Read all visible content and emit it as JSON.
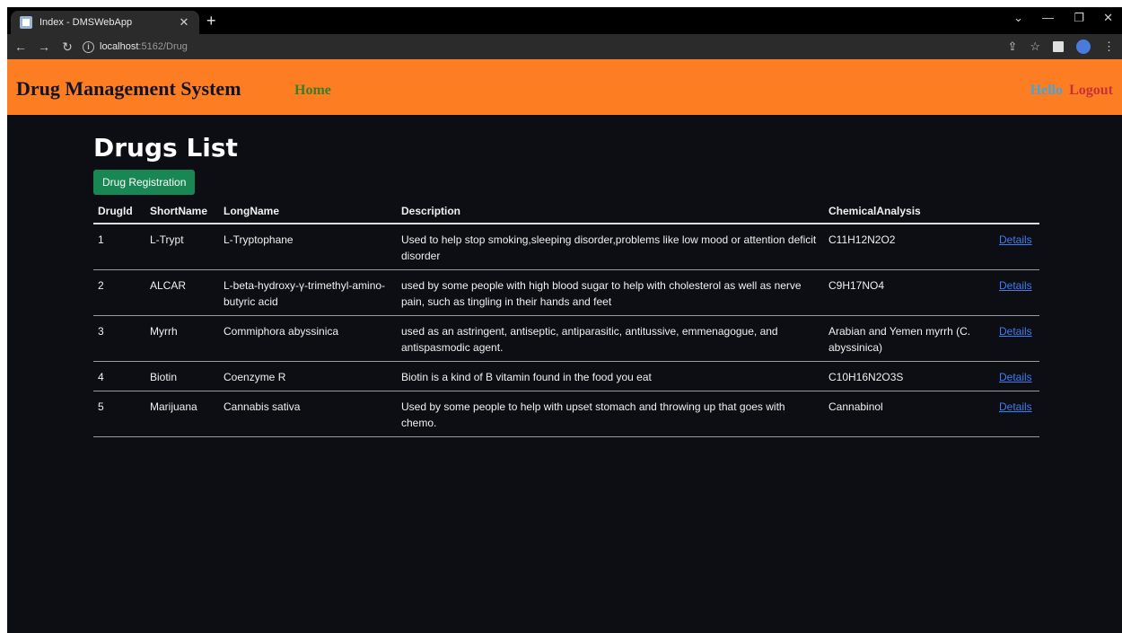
{
  "browser": {
    "tab_title": "Index - DMSWebApp",
    "url_host": "localhost",
    "url_path": ":5162/Drug"
  },
  "navbar": {
    "brand": "Drug Management System",
    "home": "Home",
    "hello": "Hello",
    "logout": "Logout"
  },
  "page": {
    "title": "Drugs List",
    "register_button": "Drug Registration"
  },
  "table": {
    "headers": [
      "DrugId",
      "ShortName",
      "LongName",
      "Description",
      "ChemicalAnalysis",
      ""
    ],
    "rows": [
      {
        "id": "1",
        "short": "L-Trypt",
        "long": "L-Tryptophane",
        "desc": "Used to help stop smoking,sleeping disorder,problems like low mood or attention deficit disorder",
        "chem": "C11H12N2O2",
        "link": "Details"
      },
      {
        "id": "2",
        "short": "ALCAR",
        "long": "L-beta-hydroxy-γ-trimethyl-amino-butyric acid",
        "desc": "used by some people with high blood sugar to help with cholesterol as well as nerve pain, such as tingling in their hands and feet",
        "chem": "C9H17NO4",
        "link": "Details"
      },
      {
        "id": "3",
        "short": "Myrrh",
        "long": "Commiphora abyssinica",
        "desc": "used as an astringent, antiseptic, antiparasitic, antitussive, emmenagogue, and antispasmodic agent.",
        "chem": "Arabian and Yemen myrrh (C. abyssinica)",
        "link": "Details"
      },
      {
        "id": "4",
        "short": "Biotin",
        "long": "Coenzyme R",
        "desc": "Biotin is a kind of B vitamin found in the food you eat",
        "chem": "C10H16N2O3S",
        "link": "Details"
      },
      {
        "id": "5",
        "short": "Marijuana",
        "long": "Cannabis sativa",
        "desc": "Used by some people to help with upset stomach and throwing up that goes with chemo.",
        "chem": "Cannabinol",
        "link": "Details"
      }
    ]
  },
  "colors": {
    "navbar_bg": "#fd7e22",
    "page_bg": "#0d0d14",
    "button_green": "#198754",
    "link_blue": "#3d7ef0"
  }
}
